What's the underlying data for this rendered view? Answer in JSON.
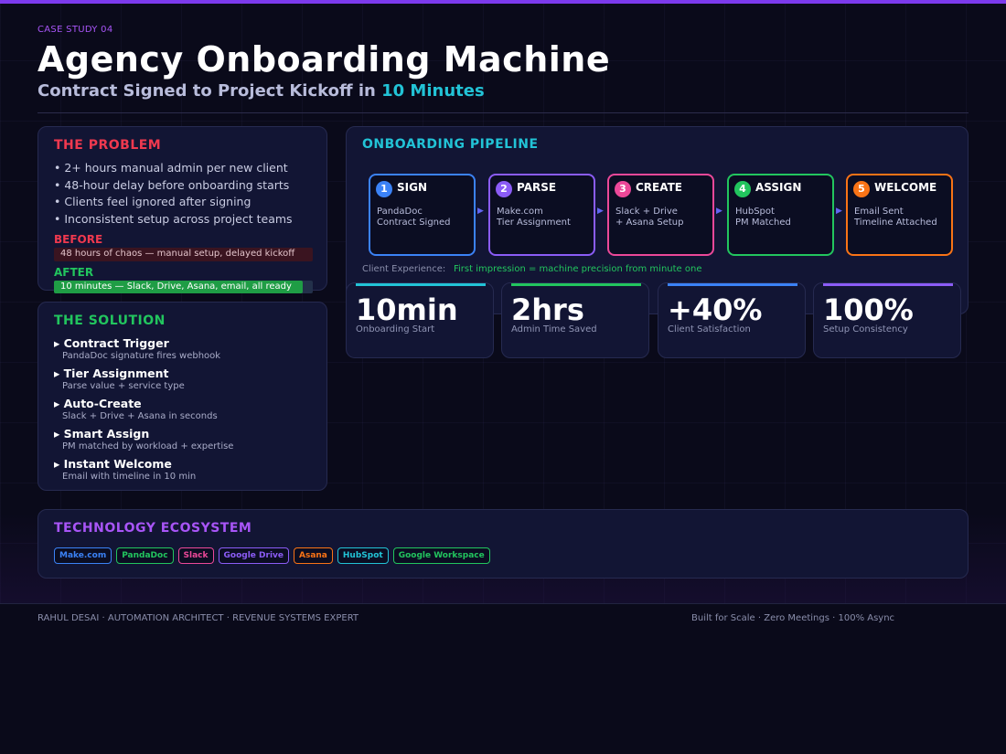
{
  "header": {
    "eyebrow": "CASE STUDY 04",
    "title": "Agency Onboarding Machine",
    "subtitle_prefix": "Contract Signed to Project Kickoff in",
    "subtitle_highlight": "10 Minutes"
  },
  "problem": {
    "title": "THE PROBLEM",
    "bullets": [
      "• 2+ hours manual admin per new client",
      "• 48-hour delay before onboarding starts",
      "• Clients feel ignored after signing",
      "• Inconsistent setup across project teams"
    ],
    "before_label": "BEFORE",
    "before_text": "48 hours of chaos — manual setup, delayed kickoff",
    "after_label": "AFTER",
    "after_text": "10 minutes — Slack, Drive, Asana, email, all ready",
    "after_fill_fraction": 0.96
  },
  "solution": {
    "title": "THE SOLUTION",
    "items": [
      {
        "head": "▸ Contract Trigger",
        "desc": "PandaDoc signature fires webhook"
      },
      {
        "head": "▸ Tier Assignment",
        "desc": "Parse value + service type"
      },
      {
        "head": "▸ Auto-Create",
        "desc": "Slack + Drive + Asana in seconds"
      },
      {
        "head": "▸ Smart Assign",
        "desc": "PM matched by workload + expertise"
      },
      {
        "head": "▸ Instant Welcome",
        "desc": "Email with timeline in 10 min"
      }
    ]
  },
  "pipeline": {
    "title": "ONBOARDING PIPELINE",
    "steps": [
      {
        "num": "1",
        "name": "SIGN",
        "line1": "PandaDoc",
        "line2": "Contract Signed",
        "color": "#3b82f6"
      },
      {
        "num": "2",
        "name": "PARSE",
        "line1": "Make.com",
        "line2": "Tier Assignment",
        "color": "#8b5cf6"
      },
      {
        "num": "3",
        "name": "CREATE",
        "line1": "Slack + Drive",
        "line2": "+ Asana Setup",
        "color": "#ec4899"
      },
      {
        "num": "4",
        "name": "ASSIGN",
        "line1": "HubSpot",
        "line2": "PM Matched",
        "color": "#22c55e"
      },
      {
        "num": "5",
        "name": "WELCOME",
        "line1": "Email Sent",
        "line2": "Timeline Attached",
        "color": "#f97316"
      }
    ],
    "arrow_glyph": "▶",
    "experience_label": "Client Experience:",
    "experience_value": "First impression = machine precision from minute one"
  },
  "metrics": [
    {
      "value": "10min",
      "label": "Onboarding Start",
      "color": "#22c3d6"
    },
    {
      "value": "2hrs",
      "label": "Admin Time Saved",
      "color": "#22c55e"
    },
    {
      "value": "+40%",
      "label": "Client Satisfaction",
      "color": "#3b82f6"
    },
    {
      "value": "100%",
      "label": "Setup Consistency",
      "color": "#8b5cf6"
    }
  ],
  "tech": {
    "title": "TECHNOLOGY ECOSYSTEM",
    "tags": [
      {
        "label": "Make.com",
        "color": "#3b82f6"
      },
      {
        "label": "PandaDoc",
        "color": "#22c55e"
      },
      {
        "label": "Slack",
        "color": "#ec4899"
      },
      {
        "label": "Google Drive",
        "color": "#8b5cf6"
      },
      {
        "label": "Asana",
        "color": "#f97316"
      },
      {
        "label": "HubSpot",
        "color": "#22c3d6"
      },
      {
        "label": "Google Workspace",
        "color": "#22c55e"
      }
    ]
  },
  "footer": {
    "left": "RAHUL DESAI  ·  AUTOMATION ARCHITECT  ·  REVENUE SYSTEMS EXPERT",
    "right": "Built for Scale · Zero Meetings · 100% Async"
  }
}
